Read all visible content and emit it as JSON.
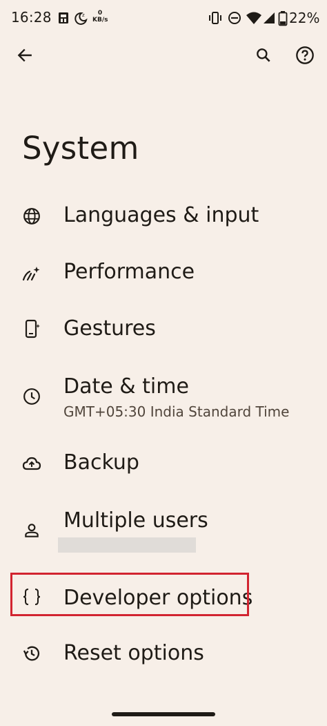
{
  "status_bar": {
    "time": "16:28",
    "net_speed_value": "0",
    "net_speed_unit": "KB/s",
    "battery_percent": "22%",
    "icons": [
      "app-notification-icon",
      "do-not-disturb-moon-icon",
      "network-speed-indicator",
      "vibrate-icon",
      "dnd-circle-icon",
      "wifi-icon",
      "cell-signal-icon",
      "battery-icon"
    ]
  },
  "app_bar": {
    "back_icon": "arrow-back-icon",
    "search_icon": "search-icon",
    "help_icon": "help-icon"
  },
  "page": {
    "title": "System"
  },
  "settings": [
    {
      "icon": "globe-icon",
      "label": "Languages & input"
    },
    {
      "icon": "performance-icon",
      "label": "Performance"
    },
    {
      "icon": "gestures-phone-icon",
      "label": "Gestures"
    },
    {
      "icon": "clock-icon",
      "label": "Date & time",
      "summary": "GMT+05:30 India Standard Time"
    },
    {
      "icon": "cloud-upload-icon",
      "label": "Backup"
    },
    {
      "icon": "person-icon",
      "label": "Multiple users"
    },
    {
      "icon": "code-braces-icon",
      "label": "Developer options",
      "highlighted": true
    },
    {
      "icon": "history-icon",
      "label": "Reset options"
    }
  ],
  "colors": {
    "background": "#f7efe8",
    "text": "#1f1b16",
    "highlight_border": "#d22430"
  }
}
